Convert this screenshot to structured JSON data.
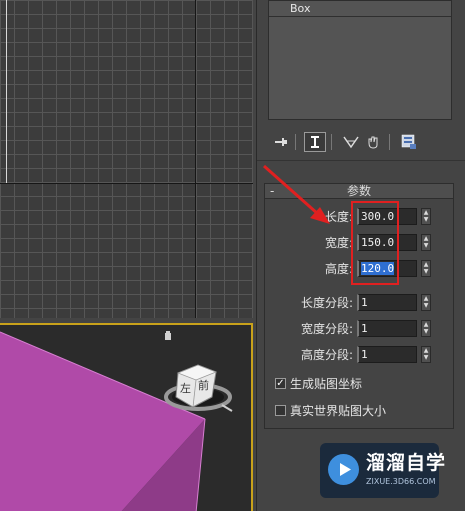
{
  "object_list": {
    "selected_item": "Box"
  },
  "rollout": {
    "collapse_symbol": "-",
    "title": "参数"
  },
  "params": {
    "length": {
      "label": "长度:",
      "value": "300.0"
    },
    "width": {
      "label": "宽度:",
      "value": "150.0"
    },
    "height": {
      "label": "高度:",
      "value": "120.0"
    },
    "length_segs": {
      "label": "长度分段:",
      "value": "1"
    },
    "width_segs": {
      "label": "宽度分段:",
      "value": "1"
    },
    "height_segs": {
      "label": "高度分段:",
      "value": "1"
    }
  },
  "checkboxes": {
    "gen_map_coords": {
      "label": "生成贴图坐标",
      "checked": true,
      "mark": "✓"
    },
    "real_world_map": {
      "label": "真实世界贴图大小",
      "checked": false,
      "mark": ""
    }
  },
  "viewcube": {
    "face_left": "左",
    "face_front": "前"
  },
  "watermark": {
    "name": "溜溜自学",
    "url": "ZIXUE.3D66.COM"
  },
  "colors": {
    "box_face": "#b04aa8",
    "box_top": "#c75bbf",
    "viewport_border": "#c9a21b",
    "highlight_box": "#e02020",
    "selection": "#2f6fd1"
  },
  "icons": [
    "pin-stack-icon",
    "show-end-result-icon",
    "make-unique-icon",
    "remove-modifier-icon",
    "configure-sets-icon",
    "camera-icon",
    "arrow-annotation-icon"
  ]
}
